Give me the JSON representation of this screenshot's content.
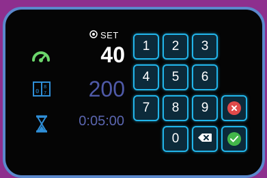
{
  "status": {
    "set_label": "SET",
    "speed_value": "40",
    "distance_value": "200",
    "time_value": "0:05:00"
  },
  "icons": {
    "speed": "gauge-icon",
    "counter": "counter-icon",
    "time": "hourglass-icon",
    "set": "target-icon"
  },
  "keypad": {
    "keys": [
      "1",
      "2",
      "3",
      "4",
      "5",
      "6",
      "7",
      "8",
      "9",
      "0"
    ],
    "cancel": "cancel-icon",
    "backspace": "backspace-icon",
    "confirm": "confirm-icon"
  },
  "colors": {
    "accent": "#22b5ea",
    "cancel": "#e04a4a",
    "confirm": "#43b64a",
    "gauge": "#6bd56b",
    "counter": "#2f8fd8",
    "hourglass": "#2f8fd8",
    "background": "#8e2f8e"
  }
}
